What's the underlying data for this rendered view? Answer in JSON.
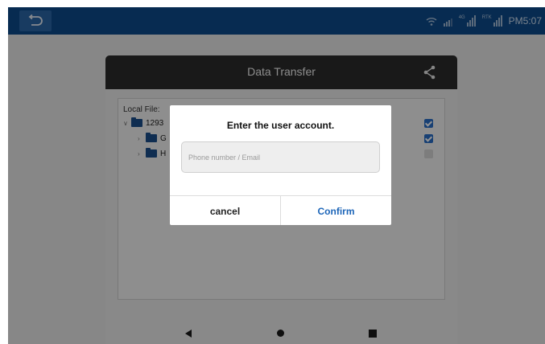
{
  "status_bar": {
    "time": "PM5:07",
    "signal1_label": "4G",
    "signal2_label": "RTK"
  },
  "app": {
    "title": "Data Transfer",
    "local_file_label": "Local File:",
    "tree": [
      {
        "name": "1293",
        "checked": true
      },
      {
        "name": "G",
        "checked": true
      },
      {
        "name": "H",
        "checked": false
      }
    ]
  },
  "dialog": {
    "title": "Enter the user account.",
    "input_placeholder": "Phone number / Email",
    "input_value": "",
    "cancel_label": "cancel",
    "confirm_label": "Confirm"
  },
  "colors": {
    "status_bar": "#0d4a8c",
    "accent": "#1c65b8",
    "header": "#2b2b2b"
  }
}
